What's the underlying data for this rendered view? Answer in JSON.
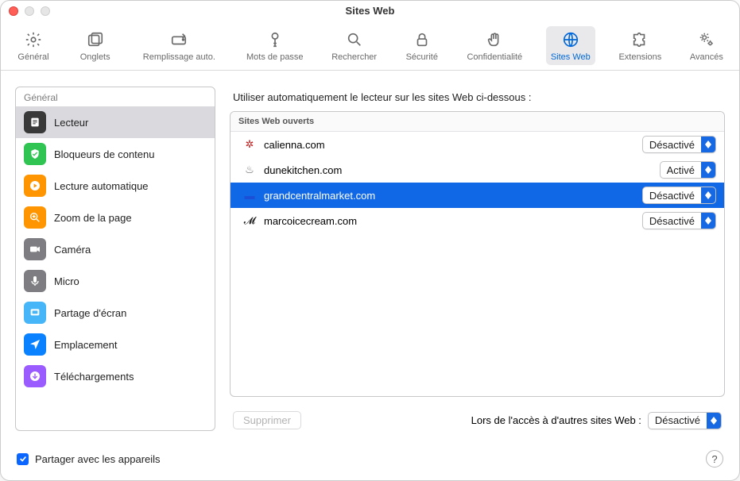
{
  "window": {
    "title": "Sites Web"
  },
  "toolbar": {
    "items": [
      {
        "label": "Général",
        "icon": "gear"
      },
      {
        "label": "Onglets",
        "icon": "tabs"
      },
      {
        "label": "Remplissage auto.",
        "icon": "autofill",
        "wide": true
      },
      {
        "label": "Mots de passe",
        "icon": "key"
      },
      {
        "label": "Rechercher",
        "icon": "search"
      },
      {
        "label": "Sécurité",
        "icon": "lock"
      },
      {
        "label": "Confidentialité",
        "icon": "hand"
      },
      {
        "label": "Sites Web",
        "icon": "globe",
        "active": true
      },
      {
        "label": "Extensions",
        "icon": "puzzle"
      },
      {
        "label": "Avancés",
        "icon": "gears"
      }
    ]
  },
  "sidebar": {
    "header": "Général",
    "items": [
      {
        "label": "Lecteur",
        "icon": "reader",
        "color": "c-dark",
        "selected": true
      },
      {
        "label": "Bloqueurs de contenu",
        "icon": "shield",
        "color": "c-green"
      },
      {
        "label": "Lecture automatique",
        "icon": "play",
        "color": "c-orange"
      },
      {
        "label": "Zoom de la page",
        "icon": "zoom",
        "color": "c-orange"
      },
      {
        "label": "Caméra",
        "icon": "camera",
        "color": "c-gray"
      },
      {
        "label": "Micro",
        "icon": "mic",
        "color": "c-gray"
      },
      {
        "label": "Partage d'écran",
        "icon": "screen",
        "color": "c-blue"
      },
      {
        "label": "Emplacement",
        "icon": "location",
        "color": "c-blue2"
      },
      {
        "label": "Téléchargements",
        "icon": "download",
        "color": "c-purple"
      }
    ]
  },
  "main": {
    "title": "Utiliser automatiquement le lecteur sur les sites Web ci-dessous :",
    "column_header": "Sites Web ouverts",
    "rows": [
      {
        "domain": "calienna.com",
        "value": "Désactivé",
        "fav": "fav-red",
        "glyph": "✲"
      },
      {
        "domain": "dunekitchen.com",
        "value": "Activé",
        "fav": "fav-gray",
        "glyph": "♨"
      },
      {
        "domain": "grandcentralmarket.com",
        "value": "Désactivé",
        "fav": "fav-blue",
        "glyph": "▬",
        "selected": true
      },
      {
        "domain": "marcoicecream.com",
        "value": "Désactivé",
        "fav": "fav-black",
        "glyph": "𝓜"
      }
    ],
    "delete_label": "Supprimer",
    "other_sites_label": "Lors de l'accès à d'autres sites Web :",
    "other_sites_value": "Désactivé"
  },
  "footer": {
    "checkbox_label": "Partager avec les appareils",
    "checkbox_checked": true
  }
}
